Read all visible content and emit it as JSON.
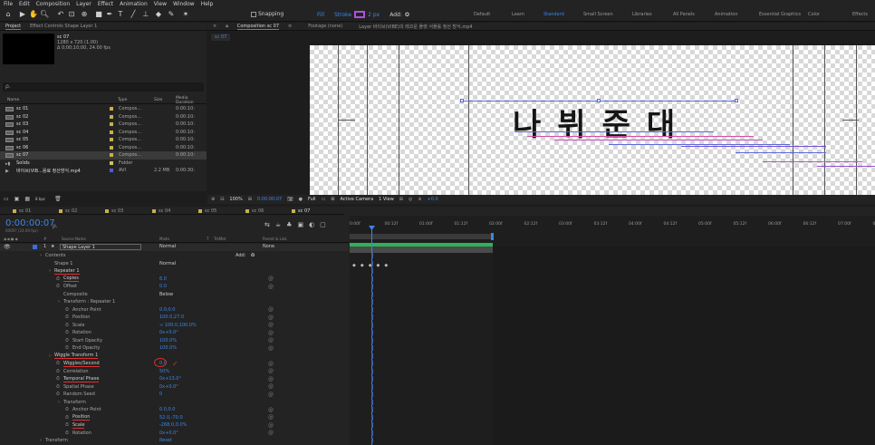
{
  "menu": [
    "File",
    "Edit",
    "Composition",
    "Layer",
    "Effect",
    "Animation",
    "View",
    "Window",
    "Help"
  ],
  "toolbar": {
    "snapping": "Snapping",
    "fill": "Fill",
    "stroke": "Stroke",
    "stroke_px": "2 px",
    "add": "Add:",
    "workspaces": [
      "Default",
      "Learn",
      "Standard",
      "Small Screen",
      "Libraries",
      "All Panels",
      "Animation",
      "Essential Graphics",
      "Color",
      "Effects"
    ],
    "active_workspace": "Standard",
    "accent": "#3b86e8"
  },
  "project": {
    "tab": "Project",
    "effect_tab": "Effect Controls Shape Layer 1",
    "selected": "sc 07",
    "dims": "1280 x 720 (1.00)",
    "duration": "Δ 0;00;10;00, 24.00 fps",
    "search_placeholder": "ρ.",
    "headers": [
      "Name",
      "Type",
      "Size",
      "Media Duration"
    ],
    "items": [
      {
        "name": "sc 01",
        "type": "Compos...",
        "size": "",
        "dur": "0:00:10:"
      },
      {
        "name": "sc 02",
        "type": "Compos...",
        "size": "",
        "dur": "0:00:10:"
      },
      {
        "name": "sc 03",
        "type": "Compos...",
        "size": "",
        "dur": "0:00:10:"
      },
      {
        "name": "sc 04",
        "type": "Compos...",
        "size": "",
        "dur": "0:00:10:"
      },
      {
        "name": "sc 05",
        "type": "Compos...",
        "size": "",
        "dur": "0:00:10:"
      },
      {
        "name": "sc 06",
        "type": "Compos...",
        "size": "",
        "dur": "0:00:10:"
      },
      {
        "name": "sc 07",
        "type": "Compos...",
        "size": "",
        "dur": "0:00:10:"
      },
      {
        "name": "Solids",
        "type": "Folder",
        "size": "",
        "dur": ""
      },
      {
        "name": "바이브(VIB...용료 정산방식.mp4",
        "type": "AVI",
        "size": "2.2 MB",
        "dur": "0:00:30:"
      }
    ],
    "bpc": "8 bpc"
  },
  "viewer": {
    "comp_tab": "Composition sc 07",
    "footage_tab": "Footage (none)",
    "layer_tab": "Layer 바이브(VIBE)의 레코운 플랫 서플롤 정산 방식.mp4",
    "sub_tab": "sc 07",
    "title_chars": [
      "나",
      "뷔",
      "준",
      "대"
    ],
    "zoom": "100%",
    "timecode": "0:00:00:07",
    "quality": "Full",
    "camera": "Active Camera",
    "view": "1 View",
    "exposure": "+0.0"
  },
  "timeline": {
    "tabs": [
      "sc 01",
      "sc 02",
      "sc 03",
      "sc 04",
      "sc 05",
      "sc 06",
      "sc 07"
    ],
    "active_tab": "sc 07",
    "timecode": "0:00:00:07",
    "fps_note": "00007 (24.00 fps)",
    "col_headers": [
      "#",
      "Source Name",
      "Mode",
      "T",
      "TrkMat",
      "Parent & Link"
    ],
    "layer": {
      "num": "1",
      "name": "Shape Layer 1",
      "mode": "Normal",
      "parent": "None"
    },
    "ruler": [
      "0:00f",
      "00:12f",
      "01:00f",
      "01:12f",
      "02:00f",
      "02:12f",
      "03:00f",
      "03:12f",
      "04:00f",
      "04:12f",
      "05:00f",
      "05:12f",
      "06:00f",
      "06:12f",
      "07:00f",
      "07:1"
    ],
    "rows": [
      {
        "indent": 1,
        "label": "Contents",
        "value": "",
        "extra": "Add:"
      },
      {
        "indent": 2,
        "label": "Shape 1",
        "value": "Normal",
        "kind": "select"
      },
      {
        "indent": 2,
        "label": "Repeater 1",
        "value": "",
        "red": true
      },
      {
        "indent": 3,
        "label": "Copies",
        "value": "6.0",
        "red": true
      },
      {
        "indent": 3,
        "label": "Offset",
        "value": "0.0"
      },
      {
        "indent": 3,
        "label": "Composite",
        "value": "Below",
        "kind": "select"
      },
      {
        "indent": 3,
        "label": "Transform : Repeater 1",
        "value": ""
      },
      {
        "indent": 4,
        "label": "Anchor Point",
        "value": "0.0,0.0"
      },
      {
        "indent": 4,
        "label": "Position",
        "value": "100.0,27.0"
      },
      {
        "indent": 4,
        "label": "Scale",
        "value": "∞ 100.0,100.0%"
      },
      {
        "indent": 4,
        "label": "Rotation",
        "value": "0x+0.0°"
      },
      {
        "indent": 4,
        "label": "Start Opacity",
        "value": "100.0%"
      },
      {
        "indent": 4,
        "label": "End Opacity",
        "value": "100.0%"
      },
      {
        "indent": 2,
        "label": "Wiggle Transform 1",
        "value": "",
        "red": true
      },
      {
        "indent": 3,
        "label": "Wiggles/Second",
        "value": "0.0",
        "red": true
      },
      {
        "indent": 3,
        "label": "Correlation",
        "value": "50%"
      },
      {
        "indent": 3,
        "label": "Temporal Phase",
        "value": "0x+13.0°",
        "red": true
      },
      {
        "indent": 3,
        "label": "Spatial Phase",
        "value": "0x+0.0°"
      },
      {
        "indent": 3,
        "label": "Random Seed",
        "value": "0"
      },
      {
        "indent": 3,
        "label": "Transform",
        "value": ""
      },
      {
        "indent": 4,
        "label": "Anchor Point",
        "value": "0.0,0.0"
      },
      {
        "indent": 4,
        "label": "Position",
        "value": "52.0,-70.0",
        "red": true
      },
      {
        "indent": 4,
        "label": "Scale",
        "value": "-268.0,0.0%",
        "red": true
      },
      {
        "indent": 4,
        "label": "Rotation",
        "value": "0x+0.0°"
      },
      {
        "indent": 1,
        "label": "Transform",
        "value": "Reset"
      }
    ]
  }
}
